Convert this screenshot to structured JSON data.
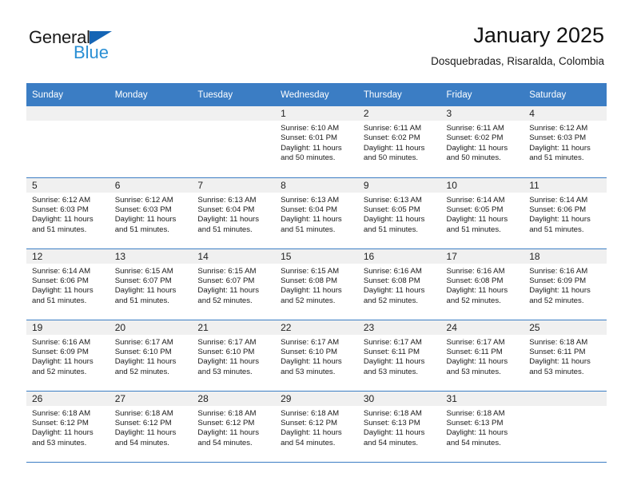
{
  "brand": {
    "name_part1": "General",
    "name_part2": "Blue",
    "accent_color": "#1565b5",
    "secondary_color": "#2a8fd4"
  },
  "header": {
    "title": "January 2025",
    "subtitle": "Dosquebradas, Risaralda, Colombia"
  },
  "theme": {
    "header_row_bg": "#3b7dc4",
    "daynum_bg": "#f0f0f0",
    "grid_line": "#3b7dc4"
  },
  "weekday_headers": [
    "Sunday",
    "Monday",
    "Tuesday",
    "Wednesday",
    "Thursday",
    "Friday",
    "Saturday"
  ],
  "weeks": [
    [
      {
        "day": "",
        "blank": true,
        "sunrise": "",
        "sunset": "",
        "daylight1": "",
        "daylight2": ""
      },
      {
        "day": "",
        "blank": true,
        "sunrise": "",
        "sunset": "",
        "daylight1": "",
        "daylight2": ""
      },
      {
        "day": "",
        "blank": true,
        "sunrise": "",
        "sunset": "",
        "daylight1": "",
        "daylight2": ""
      },
      {
        "day": "1",
        "blank": false,
        "sunrise": "Sunrise: 6:10 AM",
        "sunset": "Sunset: 6:01 PM",
        "daylight1": "Daylight: 11 hours",
        "daylight2": "and 50 minutes."
      },
      {
        "day": "2",
        "blank": false,
        "sunrise": "Sunrise: 6:11 AM",
        "sunset": "Sunset: 6:02 PM",
        "daylight1": "Daylight: 11 hours",
        "daylight2": "and 50 minutes."
      },
      {
        "day": "3",
        "blank": false,
        "sunrise": "Sunrise: 6:11 AM",
        "sunset": "Sunset: 6:02 PM",
        "daylight1": "Daylight: 11 hours",
        "daylight2": "and 50 minutes."
      },
      {
        "day": "4",
        "blank": false,
        "sunrise": "Sunrise: 6:12 AM",
        "sunset": "Sunset: 6:03 PM",
        "daylight1": "Daylight: 11 hours",
        "daylight2": "and 51 minutes."
      }
    ],
    [
      {
        "day": "5",
        "blank": false,
        "sunrise": "Sunrise: 6:12 AM",
        "sunset": "Sunset: 6:03 PM",
        "daylight1": "Daylight: 11 hours",
        "daylight2": "and 51 minutes."
      },
      {
        "day": "6",
        "blank": false,
        "sunrise": "Sunrise: 6:12 AM",
        "sunset": "Sunset: 6:03 PM",
        "daylight1": "Daylight: 11 hours",
        "daylight2": "and 51 minutes."
      },
      {
        "day": "7",
        "blank": false,
        "sunrise": "Sunrise: 6:13 AM",
        "sunset": "Sunset: 6:04 PM",
        "daylight1": "Daylight: 11 hours",
        "daylight2": "and 51 minutes."
      },
      {
        "day": "8",
        "blank": false,
        "sunrise": "Sunrise: 6:13 AM",
        "sunset": "Sunset: 6:04 PM",
        "daylight1": "Daylight: 11 hours",
        "daylight2": "and 51 minutes."
      },
      {
        "day": "9",
        "blank": false,
        "sunrise": "Sunrise: 6:13 AM",
        "sunset": "Sunset: 6:05 PM",
        "daylight1": "Daylight: 11 hours",
        "daylight2": "and 51 minutes."
      },
      {
        "day": "10",
        "blank": false,
        "sunrise": "Sunrise: 6:14 AM",
        "sunset": "Sunset: 6:05 PM",
        "daylight1": "Daylight: 11 hours",
        "daylight2": "and 51 minutes."
      },
      {
        "day": "11",
        "blank": false,
        "sunrise": "Sunrise: 6:14 AM",
        "sunset": "Sunset: 6:06 PM",
        "daylight1": "Daylight: 11 hours",
        "daylight2": "and 51 minutes."
      }
    ],
    [
      {
        "day": "12",
        "blank": false,
        "sunrise": "Sunrise: 6:14 AM",
        "sunset": "Sunset: 6:06 PM",
        "daylight1": "Daylight: 11 hours",
        "daylight2": "and 51 minutes."
      },
      {
        "day": "13",
        "blank": false,
        "sunrise": "Sunrise: 6:15 AM",
        "sunset": "Sunset: 6:07 PM",
        "daylight1": "Daylight: 11 hours",
        "daylight2": "and 51 minutes."
      },
      {
        "day": "14",
        "blank": false,
        "sunrise": "Sunrise: 6:15 AM",
        "sunset": "Sunset: 6:07 PM",
        "daylight1": "Daylight: 11 hours",
        "daylight2": "and 52 minutes."
      },
      {
        "day": "15",
        "blank": false,
        "sunrise": "Sunrise: 6:15 AM",
        "sunset": "Sunset: 6:08 PM",
        "daylight1": "Daylight: 11 hours",
        "daylight2": "and 52 minutes."
      },
      {
        "day": "16",
        "blank": false,
        "sunrise": "Sunrise: 6:16 AM",
        "sunset": "Sunset: 6:08 PM",
        "daylight1": "Daylight: 11 hours",
        "daylight2": "and 52 minutes."
      },
      {
        "day": "17",
        "blank": false,
        "sunrise": "Sunrise: 6:16 AM",
        "sunset": "Sunset: 6:08 PM",
        "daylight1": "Daylight: 11 hours",
        "daylight2": "and 52 minutes."
      },
      {
        "day": "18",
        "blank": false,
        "sunrise": "Sunrise: 6:16 AM",
        "sunset": "Sunset: 6:09 PM",
        "daylight1": "Daylight: 11 hours",
        "daylight2": "and 52 minutes."
      }
    ],
    [
      {
        "day": "19",
        "blank": false,
        "sunrise": "Sunrise: 6:16 AM",
        "sunset": "Sunset: 6:09 PM",
        "daylight1": "Daylight: 11 hours",
        "daylight2": "and 52 minutes."
      },
      {
        "day": "20",
        "blank": false,
        "sunrise": "Sunrise: 6:17 AM",
        "sunset": "Sunset: 6:10 PM",
        "daylight1": "Daylight: 11 hours",
        "daylight2": "and 52 minutes."
      },
      {
        "day": "21",
        "blank": false,
        "sunrise": "Sunrise: 6:17 AM",
        "sunset": "Sunset: 6:10 PM",
        "daylight1": "Daylight: 11 hours",
        "daylight2": "and 53 minutes."
      },
      {
        "day": "22",
        "blank": false,
        "sunrise": "Sunrise: 6:17 AM",
        "sunset": "Sunset: 6:10 PM",
        "daylight1": "Daylight: 11 hours",
        "daylight2": "and 53 minutes."
      },
      {
        "day": "23",
        "blank": false,
        "sunrise": "Sunrise: 6:17 AM",
        "sunset": "Sunset: 6:11 PM",
        "daylight1": "Daylight: 11 hours",
        "daylight2": "and 53 minutes."
      },
      {
        "day": "24",
        "blank": false,
        "sunrise": "Sunrise: 6:17 AM",
        "sunset": "Sunset: 6:11 PM",
        "daylight1": "Daylight: 11 hours",
        "daylight2": "and 53 minutes."
      },
      {
        "day": "25",
        "blank": false,
        "sunrise": "Sunrise: 6:18 AM",
        "sunset": "Sunset: 6:11 PM",
        "daylight1": "Daylight: 11 hours",
        "daylight2": "and 53 minutes."
      }
    ],
    [
      {
        "day": "26",
        "blank": false,
        "sunrise": "Sunrise: 6:18 AM",
        "sunset": "Sunset: 6:12 PM",
        "daylight1": "Daylight: 11 hours",
        "daylight2": "and 53 minutes."
      },
      {
        "day": "27",
        "blank": false,
        "sunrise": "Sunrise: 6:18 AM",
        "sunset": "Sunset: 6:12 PM",
        "daylight1": "Daylight: 11 hours",
        "daylight2": "and 54 minutes."
      },
      {
        "day": "28",
        "blank": false,
        "sunrise": "Sunrise: 6:18 AM",
        "sunset": "Sunset: 6:12 PM",
        "daylight1": "Daylight: 11 hours",
        "daylight2": "and 54 minutes."
      },
      {
        "day": "29",
        "blank": false,
        "sunrise": "Sunrise: 6:18 AM",
        "sunset": "Sunset: 6:12 PM",
        "daylight1": "Daylight: 11 hours",
        "daylight2": "and 54 minutes."
      },
      {
        "day": "30",
        "blank": false,
        "sunrise": "Sunrise: 6:18 AM",
        "sunset": "Sunset: 6:13 PM",
        "daylight1": "Daylight: 11 hours",
        "daylight2": "and 54 minutes."
      },
      {
        "day": "31",
        "blank": false,
        "sunrise": "Sunrise: 6:18 AM",
        "sunset": "Sunset: 6:13 PM",
        "daylight1": "Daylight: 11 hours",
        "daylight2": "and 54 minutes."
      },
      {
        "day": "",
        "blank": true,
        "sunrise": "",
        "sunset": "",
        "daylight1": "",
        "daylight2": ""
      }
    ]
  ]
}
